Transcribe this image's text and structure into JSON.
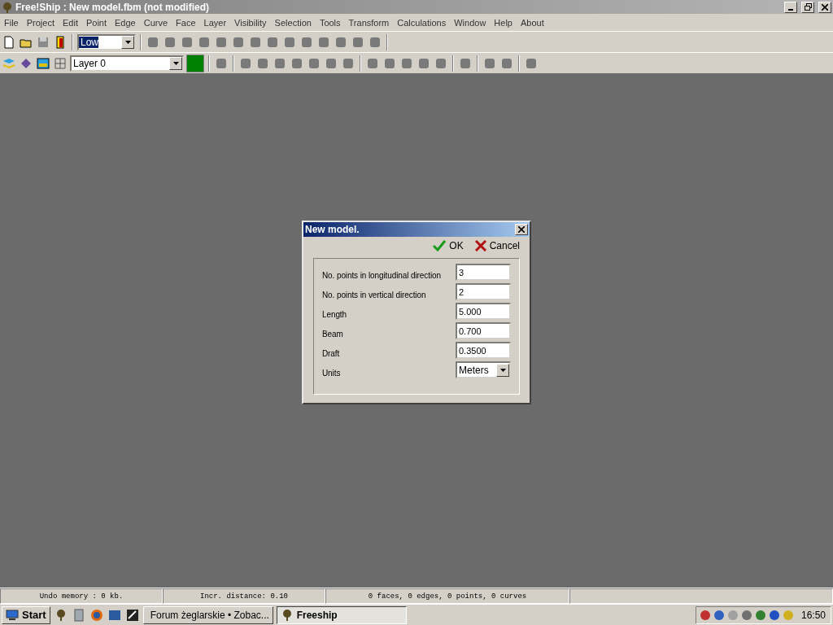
{
  "window": {
    "title": "Free!Ship  : New model.fbm (not modified)"
  },
  "menu": [
    "File",
    "Project",
    "Edit",
    "Point",
    "Edge",
    "Curve",
    "Face",
    "Layer",
    "Visibility",
    "Selection",
    "Tools",
    "Transform",
    "Calculations",
    "Window",
    "Help",
    "About"
  ],
  "toolbar": {
    "precision_select": {
      "value": "Low"
    },
    "layer_select": {
      "value": "Layer 0"
    }
  },
  "dialog": {
    "title": "New model.",
    "buttons": [
      {
        "kind": "ok",
        "label": "OK"
      },
      {
        "kind": "cancel",
        "label": "Cancel"
      }
    ],
    "fields": [
      {
        "kind": "text",
        "label": "No. points in longitudinal direction",
        "value": "3"
      },
      {
        "kind": "text",
        "label": "No. points in vertical direction",
        "value": "2"
      },
      {
        "kind": "text",
        "label": "Length",
        "value": "5.000"
      },
      {
        "kind": "text",
        "label": "Beam",
        "value": "0.700"
      },
      {
        "kind": "text",
        "label": "Draft",
        "value": "0.3500"
      },
      {
        "kind": "select",
        "label": "Units",
        "value": "Meters"
      }
    ]
  },
  "status_bar": [
    "Undo memory : 0 kb.",
    "Incr. distance: 0.10",
    "0 faces, 0 edges, 0 points, 0 curves"
  ],
  "taskbar": {
    "start": "Start",
    "tasks": [
      {
        "label": "Forum żeglarskie • Zobac...",
        "selected": false
      },
      {
        "label": "Freeship",
        "selected": true
      }
    ],
    "clock": "16:50"
  }
}
